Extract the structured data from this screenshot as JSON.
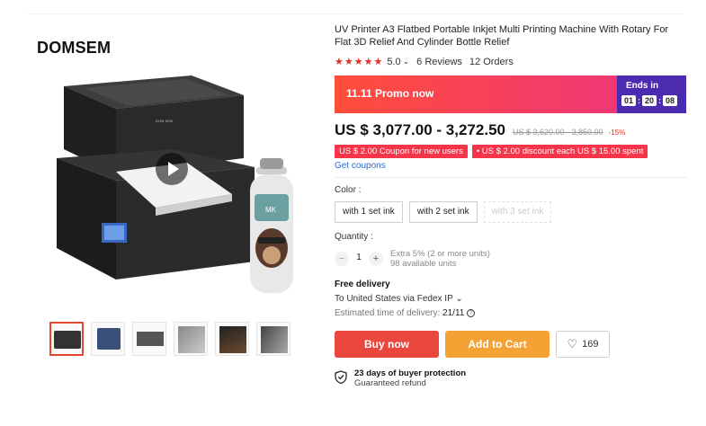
{
  "product": {
    "brand": "DOMSEM",
    "title": "UV Printer A3 Flatbed Portable Inkjet Multi Printing Machine With Rotary For Flat 3D Relief And Cylinder Bottle Relief",
    "rating": "5.0",
    "rating_chevron": "⌄",
    "reviews": "6 Reviews",
    "orders": "12 Orders",
    "stars": "★★★★★"
  },
  "promo": {
    "label": "11.11 Promo now",
    "ends_label": "Ends in",
    "hours": "01",
    "minutes": "20",
    "seconds": "08",
    "colon": ":"
  },
  "price": {
    "current": "US $ 3,077.00 - 3,272.50",
    "original": "US $ 3,620.00 - 3,850.00",
    "discount": "-15%"
  },
  "coupons": {
    "coupon1": "US $ 2.00 Coupon for new users",
    "coupon2": "• US $ 2.00 discount each US $ 15.00 spent",
    "get_coupons": "Get coupons"
  },
  "color": {
    "label": "Color :",
    "options": [
      "with 1 set ink",
      "with 2 set ink",
      "with 3 set ink"
    ]
  },
  "quantity": {
    "label": "Quantity :",
    "minus": "−",
    "value": "1",
    "plus": "+",
    "note1": "Extra 5% (2 or more units)",
    "note2": "98 available units"
  },
  "shipping": {
    "title": "Free delivery",
    "line": "To United States via Fedex IP ⌄",
    "eta_label": "Estimated time of delivery:",
    "eta_value": "21/11"
  },
  "actions": {
    "buy": "Buy now",
    "cart": "Add to Cart",
    "wishlist_count": "169",
    "heart": "♡"
  },
  "protection": {
    "title": "23 days of buyer protection",
    "subtitle": "Guaranteed refund"
  },
  "image_overlay": {
    "printer_label": "DOM SEM",
    "bottle_label": "MK"
  },
  "colors": {
    "buy": "#e9463d",
    "cart": "#f5a235",
    "promo_start": "#ff4d3a",
    "promo_end": "#e93577",
    "ends_box": "#4b2bb0",
    "coupon": "#f6344a",
    "link": "#2e6bd2"
  }
}
